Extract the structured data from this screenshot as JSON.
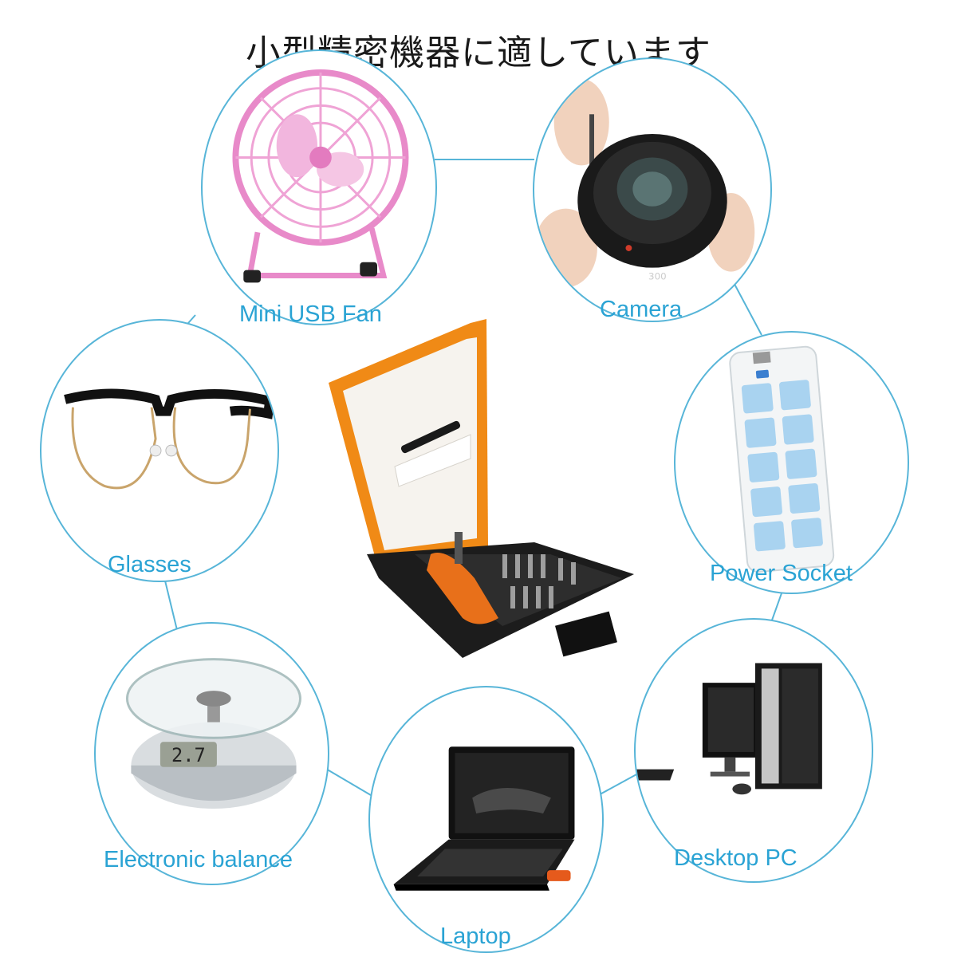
{
  "title": "小型精密機器に適しています",
  "colors": {
    "ring": "#57b5d8",
    "label": "#2aa3d4",
    "kit_orange": "#f08a16",
    "kit_black": "#1c1c1c"
  },
  "items": [
    {
      "id": "fan",
      "label": "Mini USB Fan",
      "icon": "pink-desk-fan-image"
    },
    {
      "id": "camera",
      "label": "Camera",
      "icon": "camera-lens-image"
    },
    {
      "id": "glasses",
      "label": "Glasses",
      "icon": "eyeglasses-image"
    },
    {
      "id": "socket",
      "label": "Power Socket",
      "icon": "power-strip-image"
    },
    {
      "id": "balance",
      "label": "Electronic balance",
      "icon": "digital-scale-image"
    },
    {
      "id": "laptop",
      "label": "Laptop",
      "icon": "laptop-image"
    },
    {
      "id": "desktop",
      "label": "Desktop PC",
      "icon": "desktop-pc-image"
    }
  ],
  "scale_display": "2.7",
  "camera_lens_text": "300",
  "center_product": {
    "icon": "screwdriver-kit-image"
  }
}
